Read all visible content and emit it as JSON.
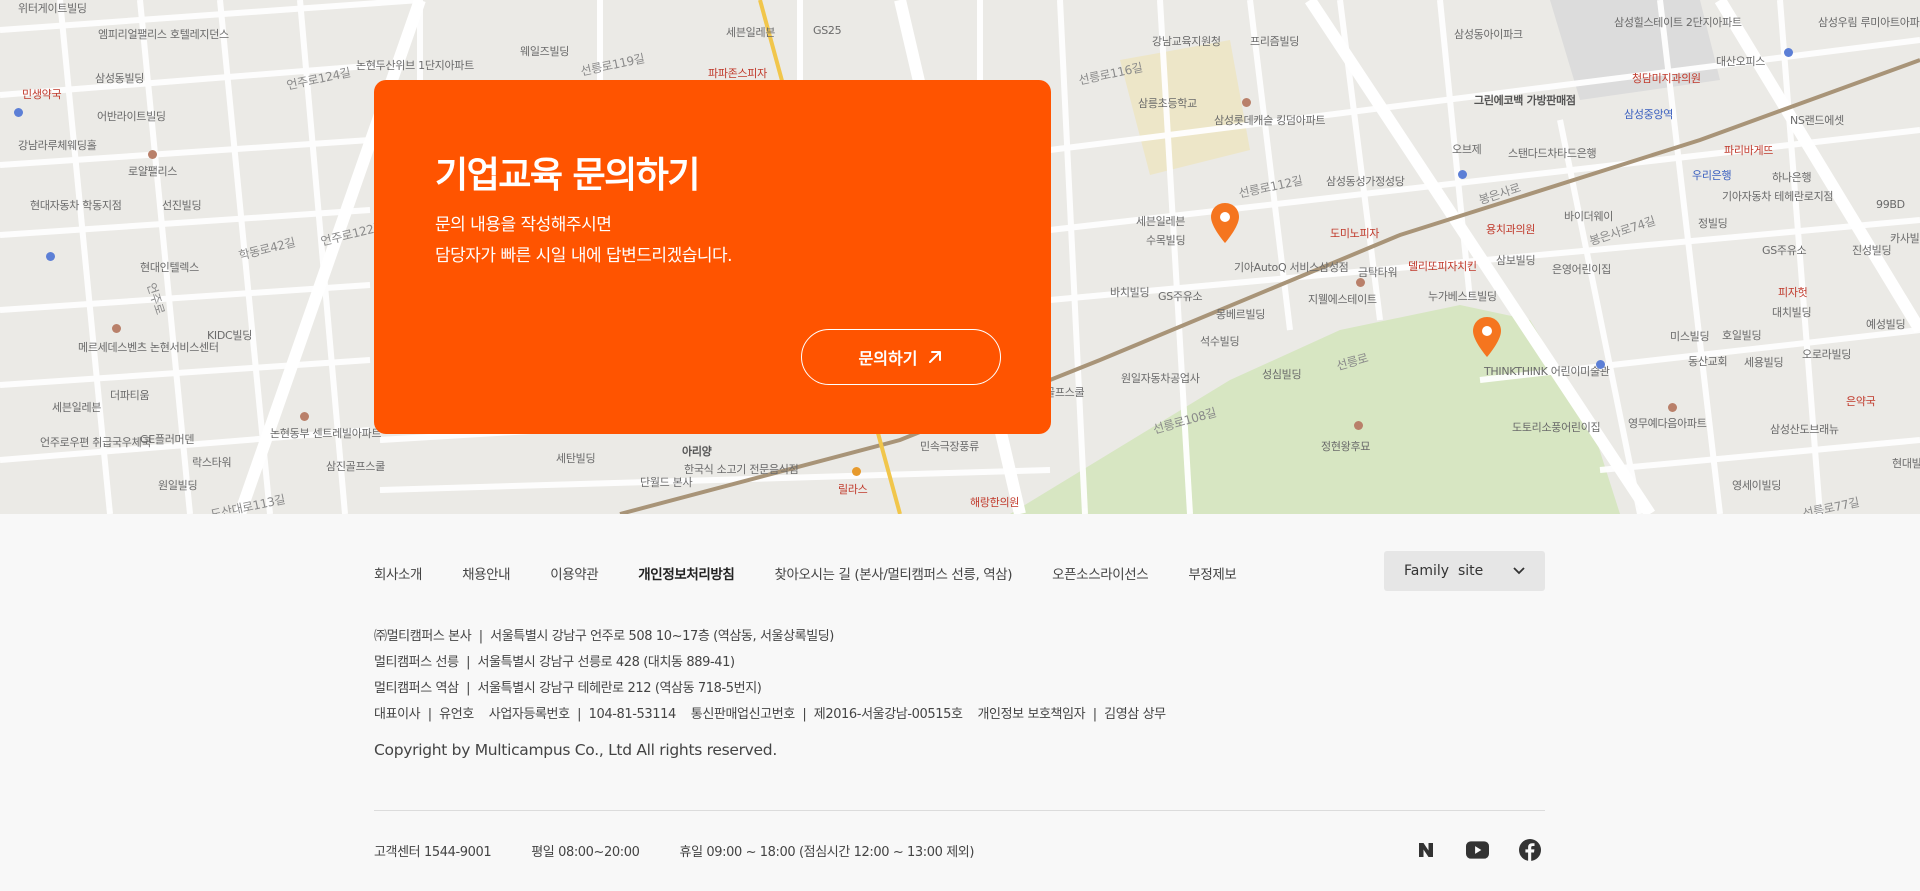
{
  "card": {
    "title": "기업교육 문의하기",
    "desc_line1": "문의 내용을 작성해주시면",
    "desc_line2": "담당자가 빠른 시일 내에 답변드리겠습니다.",
    "button": "문의하기"
  },
  "map_labels": [
    "위터게이트빌딩",
    "엠피리얼팰리스 호텔레지던스",
    "민생약국",
    "삼성동빌딩",
    "어반라이트빌딩",
    "강남라루체웨딩홀",
    "현대자동차 학동지점",
    "로얄팰리스",
    "선진빌딩",
    "현대인텔렉스",
    "KIDC빌딩",
    "메르세데스벤츠 논현서비스센터",
    "더파티움",
    "세븐일레븐",
    "GE플러머덴",
    "언주로우편 취급국우체국",
    "락스타워",
    "원일빌딩",
    "삼진골프스쿨",
    "논현동부 센트레빌아파트",
    "웨일즈빌딩",
    "논현두산위브 1단지아파트",
    "파파존스피자",
    "세븐일레븐",
    "GS25",
    "세탄빌딩",
    "아리양",
    "단월드 본사",
    "한국식 소고기 전문음식점",
    "릴라스",
    "해랑한의원",
    "민속극장풍류",
    "강남교육지원청",
    "삼릉초등학교",
    "삼성롯데캐슬 킹덤아파트",
    "프리즘빌딩",
    "삼성동성가정성당",
    "세븐일레븐",
    "수목빌딩",
    "기아AutoQ 서비스삼성점",
    "도미노피자",
    "금탁타워",
    "지웰에스테이트",
    "바치빌딩",
    "GS주유소",
    "몽베르빌딩",
    "석수빌딩",
    "성심빌딩",
    "원일자동차공업사",
    "골프스쿨",
    "정현왕후묘",
    "삼성동아이파크",
    "그린에코백 가방판매점",
    "오브제",
    "스탠다드차타드은행",
    "용치과의원",
    "바이더웨이",
    "델리또피자치킨",
    "은영어린이집",
    "누가베스트빌딩",
    "삼보빌딩",
    "THINKTHINK 어린이미술관",
    "도토리소풍어린이집",
    "영무예다음아파트",
    "삼성힐스테이트 2단지아파트",
    "대산오피스",
    "청담미지과의원",
    "삼성중앙역",
    "파리바게뜨",
    "우리은행",
    "기아자동차 테헤란로지점",
    "하나은행",
    "NS랜드에셋",
    "삼성우림 루미아트아파트",
    "정빌딩",
    "GS주유소",
    "진성빌딩",
    "피자헛",
    "대치빌딩",
    "호일빌딩",
    "미스빌딩",
    "동산교회",
    "세용빌딩",
    "오로라빌딩",
    "예성빌딩",
    "은약국",
    "삼성산도브래뉴",
    "영세이빌딩",
    "카사빌딩",
    "현대빌딩",
    "99BD"
  ],
  "road_labels": [
    "언주로124길",
    "언주로122길",
    "학동로42길",
    "선릉로119길",
    "선릉로116길",
    "선릉로112길",
    "봉은사로",
    "선릉로108길",
    "선릉로77길",
    "봉은사로74길",
    "도산대로113길",
    "언주로",
    "선릉로"
  ],
  "footer": {
    "nav": [
      "회사소개",
      "채용안내",
      "이용약관",
      "개인정보처리방침",
      "찾아오시는 길 (본사/멀티캠퍼스 선릉, 역삼)",
      "오픈소스라이선스",
      "부정제보"
    ],
    "family_site": "Family  site",
    "info": [
      "㈜멀티캠퍼스 본사  |  서울특별시 강남구 언주로 508 10~17층 (역삼동, 서울상록빌딩)",
      "멀티캠퍼스 선릉  |  서울특별시 강남구 선릉로 428 (대치동 889-41)",
      "멀티캠퍼스 역삼  |  서울특별시 강남구 테헤란로 212 (역삼동 718-5번지)",
      "대표이사  |  유언호    사업자등록번호  |  104-81-53114    통신판매업신고번호  |  제2016-서울강남-00515호    개인정보 보호책임자  |  김영삼 상무"
    ],
    "copyright": "Copyright by Multicampus Co., Ltd All rights reserved.",
    "cs": [
      "고객센터 1544-9001",
      "평일 08:00~20:00",
      "휴일 09:00 ~ 18:00 (점심시간 12:00 ~ 13:00 제외)"
    ],
    "sns": [
      "naver-blog-icon",
      "youtube-icon",
      "facebook-icon"
    ]
  },
  "colors": {
    "accent": "#ff5400",
    "footer_bg": "#f8f8f8",
    "park": "#d9e8c4"
  }
}
